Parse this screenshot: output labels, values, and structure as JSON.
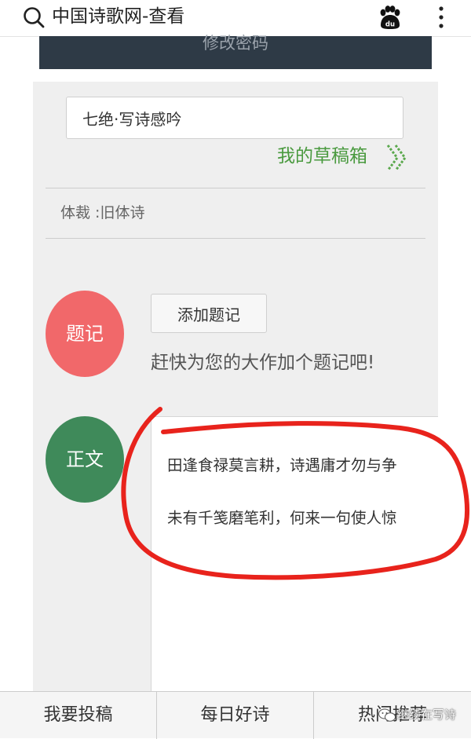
{
  "header": {
    "app_title": "中国诗歌网-查看"
  },
  "top_bar": {
    "button_label": "修改密码"
  },
  "form": {
    "title_value": "七绝·写诗感吟",
    "draft_link": "我的草稿箱",
    "genre": "体裁 :旧体诗",
    "note_badge": "题记",
    "add_note_button": "添加题记",
    "note_hint": "赶快为您的大作加个题记吧!",
    "body_badge": "正文",
    "poem_lines": [
      "田逢食禄莫言耕，诗遇庸才勿与争",
      "未有千笺磨笔利，何来一句使人惊"
    ]
  },
  "bottom_nav": {
    "items": [
      "我要投稿",
      "每日好诗",
      "热门推荐"
    ]
  },
  "watermark": "继续在写诗",
  "colors": {
    "accent_green": "#4a9a3f",
    "badge_red": "#f1686a",
    "badge_green": "#3f8a5a",
    "annotation_red": "#e8231c",
    "dark_bar": "#2e3a46"
  }
}
